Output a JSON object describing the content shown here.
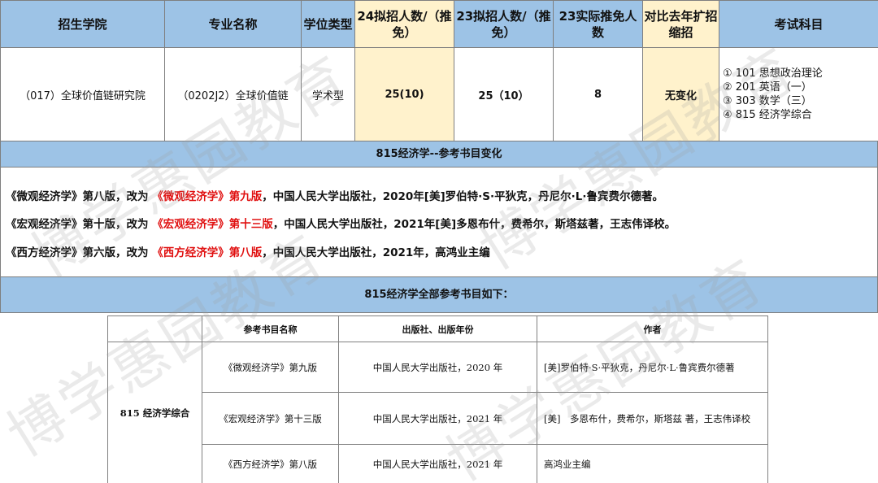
{
  "header": {
    "college": "招生学院",
    "major": "专业名称",
    "degree_type": "学位类型",
    "plan_24": "24拟招人数/（推免）",
    "plan_23": "23拟招人数/（推免）",
    "actual_23": "23实际推免人数",
    "compare": "对比去年扩招缩招",
    "subjects": "考试科目"
  },
  "row": {
    "college": "（017）全球价值链研究院",
    "major": "（0202J2）全球价值链",
    "degree_type": "学术型",
    "plan_24": "25(10)",
    "plan_23": "25（10）",
    "actual_23": "8",
    "compare": "无变化",
    "subjects": [
      "① 101 思想政治理论",
      "② 201 英语（一）",
      "③ 303 数学（三）",
      "④ 815 经济学综合"
    ]
  },
  "change_title": "815经济学--参考书目变化",
  "changes": [
    {
      "before": "《微观经济学》第八版，改为 ",
      "new": "《微观经济学》第九版",
      "after": "，中国人民大学出版社，2020年[美]罗伯特·S·平狄克，丹尼尔·L·鲁宾费尔德著。"
    },
    {
      "before": "《宏观经济学》第十版，改为 ",
      "new": "《宏观经济学》第十三版",
      "after": "，中国人民大学出版社，2021年[美]多恩布什，费希尔，斯塔兹著，王志伟译校。"
    },
    {
      "before": "《西方经济学》第六版，改为 ",
      "new": "《西方经济学》第八版",
      "after": "，中国人民大学出版社，2021年，高鸿业主编"
    }
  ],
  "ref_title": "815经济学全部参考书目如下：",
  "ref_table": {
    "headers": [
      "参考书目名称",
      "出版社、出版年份",
      "作者"
    ],
    "subject": "815 经济学综合",
    "rows": [
      {
        "book": "《微观经济学》第九版",
        "publisher": "中国人民大学出版社，2020 年",
        "author": "[美]罗伯特·S·平狄克，丹尼尔·L·鲁宾费尔德著"
      },
      {
        "book": "《宏观经济学》第十三版",
        "publisher": "中国人民大学出版社，2021 年",
        "author": "[美]　多恩布什，费希尔，斯塔兹 著，王志伟译校"
      },
      {
        "book": "《西方经济学》第八版",
        "publisher": "中国人民大学出版社，2021 年",
        "author": "高鸿业主编"
      }
    ]
  },
  "watermark": "博学惠园教育",
  "colors": {
    "header_blue": "#9dc3e6",
    "highlight_yellow": "#fff2cc",
    "change_red": "#e01010"
  }
}
